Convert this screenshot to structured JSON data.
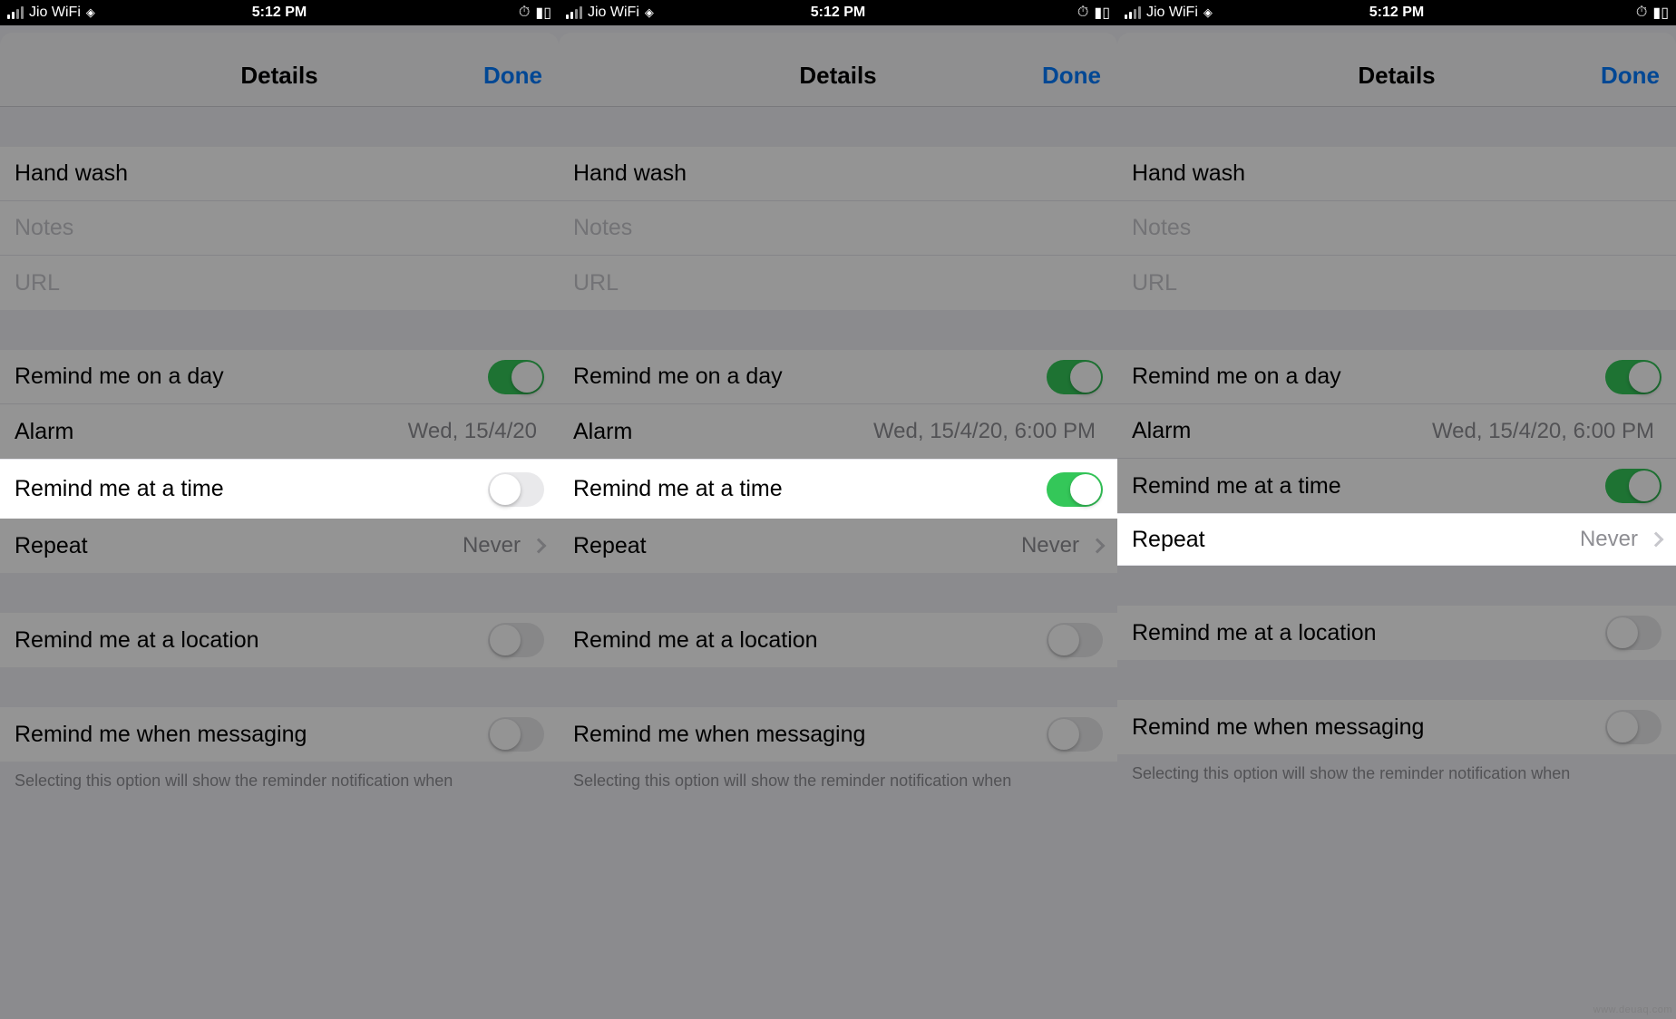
{
  "statusbar": {
    "carrier": "Jio WiFi",
    "time": "5:12 PM",
    "alarm_icon": "⏰",
    "battery_icon": "▮"
  },
  "nav": {
    "title": "Details",
    "done": "Done"
  },
  "fields": {
    "title_value": "Hand wash",
    "notes_placeholder": "Notes",
    "url_placeholder": "URL"
  },
  "rows": {
    "remind_day": "Remind me on a day",
    "alarm": "Alarm",
    "remind_time": "Remind me at a time",
    "repeat": "Repeat",
    "repeat_value": "Never",
    "remind_location": "Remind me at a location",
    "remind_messaging": "Remind me when messaging"
  },
  "screens": [
    {
      "alarm_value": "Wed, 15/4/20",
      "remind_time_on": false,
      "bright": "remind_time"
    },
    {
      "alarm_value": "Wed, 15/4/20, 6:00 PM",
      "remind_time_on": true,
      "bright": "remind_time"
    },
    {
      "alarm_value": "Wed, 15/4/20, 6:00 PM",
      "remind_time_on": true,
      "bright": "repeat"
    }
  ],
  "footer_note": "Selecting this option will show the reminder notification when",
  "watermark": "www.deuaq.com"
}
